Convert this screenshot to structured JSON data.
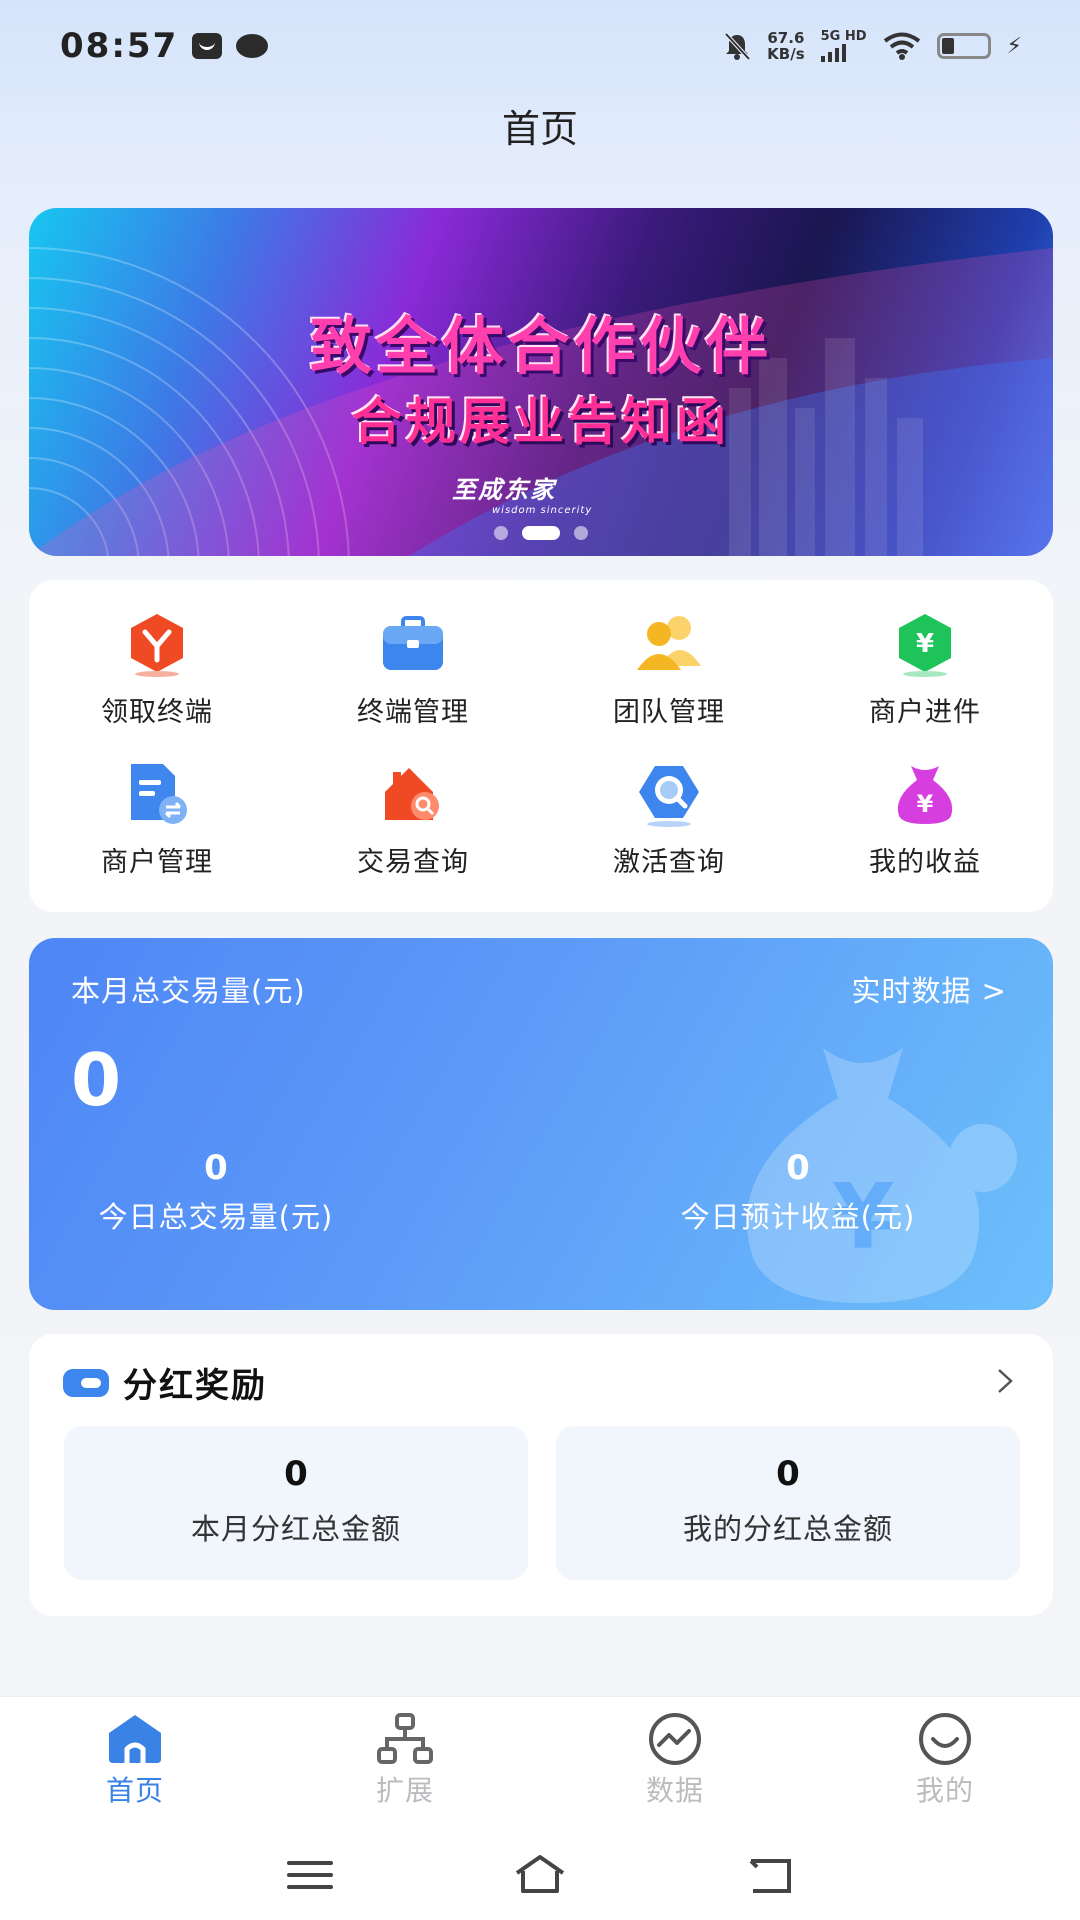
{
  "status_bar": {
    "time": "08:57",
    "net_speed_value": "67.6",
    "net_speed_unit": "KB/s",
    "network_type": "5G HD"
  },
  "header": {
    "title": "首页"
  },
  "banner": {
    "headline": "致全体合作伙伴",
    "subheadline": "合规展业告知函",
    "logo_text": "至成东家",
    "logo_tagline": "wisdom sincerity",
    "slides": 3,
    "active_slide": 2
  },
  "menu": {
    "items": [
      {
        "label": "领取终端",
        "icon": "claim-terminal-icon",
        "color": "#f04a24"
      },
      {
        "label": "终端管理",
        "icon": "briefcase-icon",
        "color": "#3d86ee"
      },
      {
        "label": "团队管理",
        "icon": "team-icon",
        "color": "#f5b624"
      },
      {
        "label": "商户进件",
        "icon": "merchant-onboard-icon",
        "color": "#1ec45a"
      },
      {
        "label": "商户管理",
        "icon": "merchant-manage-icon",
        "color": "#3f86ee"
      },
      {
        "label": "交易查询",
        "icon": "transaction-search-icon",
        "color": "#f04a24"
      },
      {
        "label": "激活查询",
        "icon": "activation-search-icon",
        "color": "#3d86ee"
      },
      {
        "label": "我的收益",
        "icon": "money-bag-icon",
        "color": "#d63ee0"
      }
    ]
  },
  "stats": {
    "month_total_label": "本月总交易量(元)",
    "realtime_link": "实时数据 >",
    "month_total_value": "0",
    "today_total_value": "0",
    "today_total_label": "今日总交易量(元)",
    "today_income_value": "0",
    "today_income_label": "今日预计收益(元)"
  },
  "dividend": {
    "title": "分红奖励",
    "month_value": "0",
    "month_label": "本月分红总金额",
    "my_value": "0",
    "my_label": "我的分红总金额"
  },
  "bottom_nav": {
    "items": [
      {
        "label": "首页",
        "active": true
      },
      {
        "label": "扩展",
        "active": false
      },
      {
        "label": "数据",
        "active": false
      },
      {
        "label": "我的",
        "active": false
      }
    ]
  },
  "colors": {
    "accent": "#3b82e6",
    "nav_inactive": "#bbbcc0",
    "stats_gradient_start": "#4e86f6",
    "stats_gradient_end": "#6cc0fb"
  }
}
